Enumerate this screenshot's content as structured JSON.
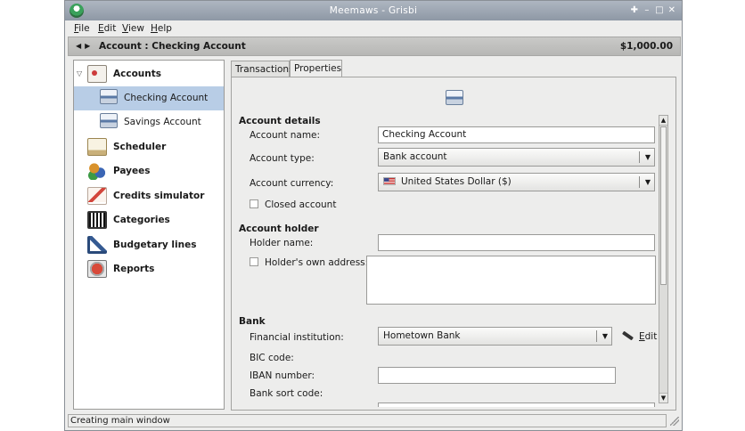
{
  "window": {
    "title": "Meemaws - Grisbi"
  },
  "menu": [
    {
      "label": "File",
      "mnemonic": "F",
      "rest": "ile"
    },
    {
      "label": "Edit",
      "mnemonic": "E",
      "rest": "dit"
    },
    {
      "label": "View",
      "mnemonic": "V",
      "rest": "iew"
    },
    {
      "label": "Help",
      "mnemonic": "H",
      "rest": "elp"
    }
  ],
  "header": {
    "title": "Account : Checking Account",
    "balance": "$1,000.00"
  },
  "sidebar": {
    "items": [
      {
        "label": "Accounts",
        "icon": "accounts-icon"
      },
      {
        "label": "Checking Account",
        "icon": "bank-card-icon",
        "selected": true
      },
      {
        "label": "Savings Account",
        "icon": "bank-card-icon"
      },
      {
        "label": "Scheduler",
        "icon": "calendar-icon"
      },
      {
        "label": "Payees",
        "icon": "payees-icon"
      },
      {
        "label": "Credits simulator",
        "icon": "chart-icon"
      },
      {
        "label": "Categories",
        "icon": "barcode-icon"
      },
      {
        "label": "Budgetary lines",
        "icon": "budget-chart-icon"
      },
      {
        "label": "Reports",
        "icon": "reports-icon"
      }
    ]
  },
  "tabs": [
    {
      "label": "Transactions"
    },
    {
      "label": "Properties",
      "active": true
    }
  ],
  "properties": {
    "account_details_title": "Account details",
    "account_name_label": "Account name:",
    "account_name_value": "Checking Account",
    "account_type_label": "Account type:",
    "account_type_value": "Bank account",
    "currency_label": "Account currency:",
    "currency_value": "United States Dollar ($)",
    "closed_account_label": "Closed account",
    "closed_account_checked": false,
    "account_holder_title": "Account holder",
    "holder_name_label": "Holder name:",
    "holder_name_value": "",
    "holders_own_address_label": "Holder's own address:",
    "holders_own_address_checked": false,
    "bank_title": "Bank",
    "financial_institution_label": "Financial institution:",
    "financial_institution_value": "Hometown Bank",
    "edit_button": {
      "label": "Edit",
      "mnemonic": "E",
      "rest": "dit"
    },
    "bic_label": "BIC code:",
    "iban_label": "IBAN number:",
    "iban_value": "",
    "bank_sort_code_label": "Bank sort code:"
  },
  "status": {
    "text": "Creating main window"
  }
}
